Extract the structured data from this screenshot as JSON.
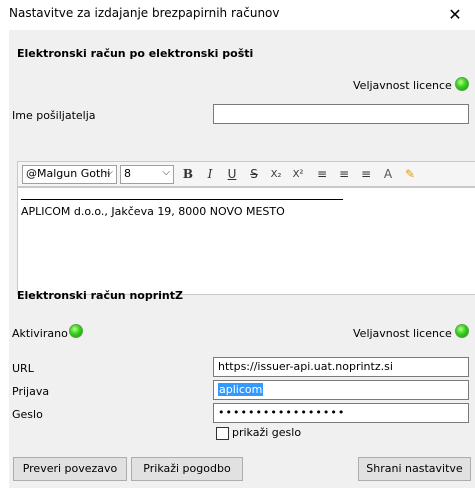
{
  "window": {
    "title": "Nastavitve za izdajanje brezpapirnih računov",
    "close_glyph": "✕"
  },
  "email_section": {
    "title": "Elektronski račun po elektronski pošti",
    "license_label": "Veljavnost licence",
    "sender_label": "Ime pošiljatelja",
    "sender_value": ""
  },
  "toolbar": {
    "font_name": "@Malgun Gothi",
    "font_size": "8",
    "bold": "B",
    "italic": "I",
    "underline": "U",
    "strike": "S",
    "subscript": "X₂",
    "superscript": "X²",
    "align_left": "≡",
    "align_center": "≡",
    "align_right": "≡",
    "font_color": "A",
    "highlight": "✎"
  },
  "editor": {
    "signature": "APLICOM d.o.o., Jakčeva 19, 8000 NOVO MESTO"
  },
  "noprintz_section": {
    "title": "Elektronski račun noprintZ",
    "activated_label": "Aktivirano",
    "license_label": "Veljavnost licence",
    "url_label": "URL",
    "url_value": "https://issuer-api.uat.noprintz.si",
    "login_label": "Prijava",
    "login_value": "aplicom",
    "password_label": "Geslo",
    "password_value": "•••••••••••••••••",
    "show_password_label": "prikaži geslo"
  },
  "buttons": {
    "check_connection": "Preveri povezavo",
    "show_contract": "Prikaži pogodbo",
    "save_settings": "Shrani nastavitve"
  }
}
